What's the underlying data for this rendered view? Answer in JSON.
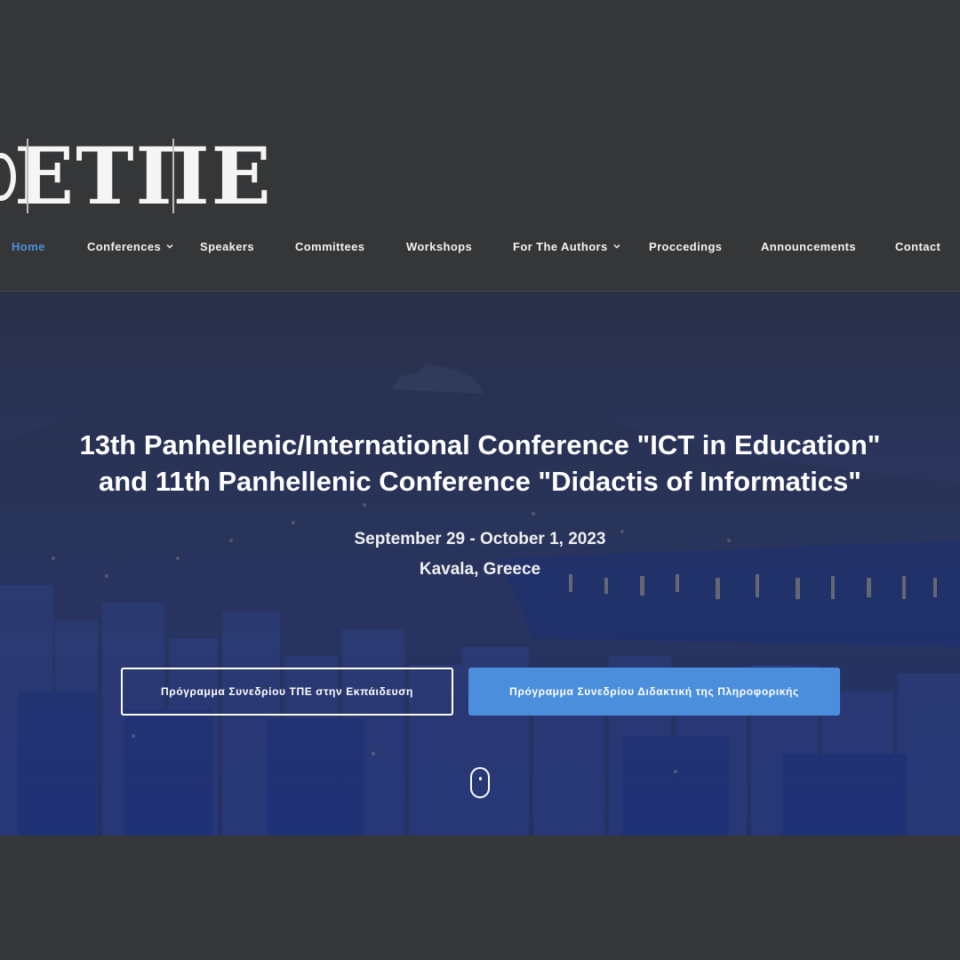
{
  "brand": {
    "logo_text": "ΕΤΠΕ"
  },
  "nav": {
    "items": [
      {
        "label": "Home",
        "active": true,
        "dropdown": false
      },
      {
        "label": "Conferences",
        "active": false,
        "dropdown": true
      },
      {
        "label": "Speakers",
        "active": false,
        "dropdown": false
      },
      {
        "label": "Committees",
        "active": false,
        "dropdown": false
      },
      {
        "label": "Workshops",
        "active": false,
        "dropdown": false
      },
      {
        "label": "For The Authors",
        "active": false,
        "dropdown": true
      },
      {
        "label": "Proccedings",
        "active": false,
        "dropdown": false
      },
      {
        "label": "Announcements",
        "active": false,
        "dropdown": false
      },
      {
        "label": "Contact",
        "active": false,
        "dropdown": false
      }
    ]
  },
  "hero": {
    "title_line1": "13th Panhellenic/International Conference \"ICT in Education\"",
    "title_line2": "and 11th Panhellenic Conference \"Didactis of Informatics\"",
    "date": "September 29 - October 1, 2023",
    "place": "Kavala, Greece",
    "button_program_ict": "Πρόγραμμα Συνεδρίου ΤΠΕ στην Εκπάιδευση",
    "button_program_informatics": "Πρόγραμμα Συνεδρίου Διδακτική της Πληροφορικής"
  },
  "colors": {
    "page_background": "#363739",
    "active_nav": "#4a90d9",
    "primary_button": "#4b8fdc",
    "hero_tint": "#283c86"
  },
  "icons": {
    "dropdown": "chevron-down-icon",
    "scroll": "mouse-scroll-icon"
  }
}
